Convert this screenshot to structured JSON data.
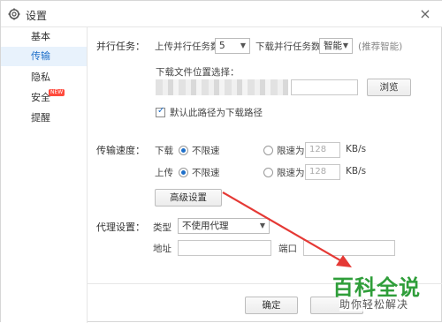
{
  "window": {
    "title": "设置",
    "close": "×"
  },
  "sidebar": {
    "items": [
      {
        "label": "基本"
      },
      {
        "label": "传输"
      },
      {
        "label": "隐私"
      },
      {
        "label": "安全",
        "badge": "NEW"
      },
      {
        "label": "提醒"
      }
    ],
    "active_index": 1
  },
  "parallel": {
    "section_label": "并行任务：",
    "upload_label": "上传并行任务数",
    "upload_value": "5",
    "download_label": "下载并行任务数",
    "download_value": "智能",
    "recommend_hint": "(推荐智能)"
  },
  "download_location": {
    "label": "下载文件位置选择：",
    "browse_button": "浏览",
    "default_checkbox_label": "默认此路径为下载路径",
    "default_checked": true
  },
  "speed": {
    "section_label": "传输速度：",
    "download": {
      "label": "下载",
      "unlimited_label": "不限速",
      "limit_label": "限速为",
      "limit_value": "128",
      "unit": "KB/s",
      "unlimited_selected": true
    },
    "upload": {
      "label": "上传",
      "unlimited_label": "不限速",
      "limit_label": "限速为",
      "limit_value": "128",
      "unit": "KB/s",
      "unlimited_selected": true
    },
    "advanced_button": "高级设置"
  },
  "proxy": {
    "section_label": "代理设置：",
    "type_label": "类型",
    "type_value": "不使用代理",
    "address_label": "地址",
    "port_label": "端口"
  },
  "footer": {
    "ok_button": "确定"
  },
  "watermark": {
    "main": "百科全说",
    "sub": "助你轻松解决"
  },
  "colors": {
    "accent": "#1e6fc9",
    "annotation_arrow": "#e53935",
    "watermark_green": "#2f9e3a",
    "badge": "#ff4a3d"
  },
  "icons": {
    "title": "gear-icon",
    "close": "close-icon",
    "dropdown": "chevron-down-icon"
  }
}
